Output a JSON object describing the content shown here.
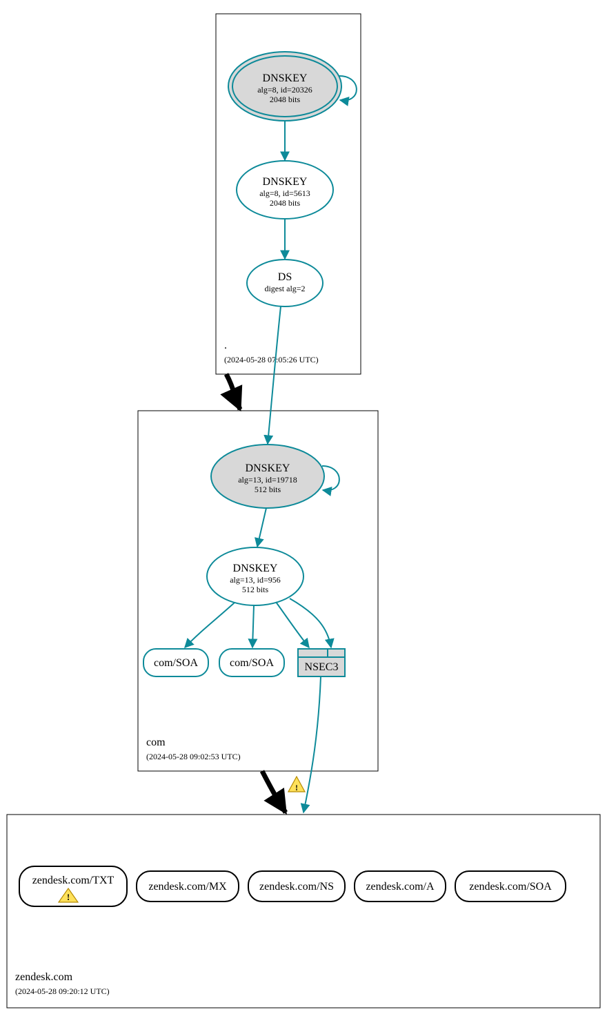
{
  "colors": {
    "teal": "#0d8a99",
    "black": "#000000",
    "gray_fill": "#d8d8d8",
    "white": "#ffffff",
    "warn_fill": "#ffe15a",
    "warn_stroke": "#b58a00"
  },
  "zones": {
    "root": {
      "name": ".",
      "timestamp": "(2024-05-28 07:05:26 UTC)"
    },
    "com": {
      "name": "com",
      "timestamp": "(2024-05-28 09:02:53 UTC)"
    },
    "zendesk": {
      "name": "zendesk.com",
      "timestamp": "(2024-05-28 09:20:12 UTC)"
    }
  },
  "nodes": {
    "root_ksk": {
      "title": "DNSKEY",
      "l1": "alg=8, id=20326",
      "l2": "2048 bits"
    },
    "root_zsk": {
      "title": "DNSKEY",
      "l1": "alg=8, id=5613",
      "l2": "2048 bits"
    },
    "root_ds": {
      "title": "DS",
      "l1": "digest alg=2"
    },
    "com_ksk": {
      "title": "DNSKEY",
      "l1": "alg=13, id=19718",
      "l2": "512 bits"
    },
    "com_zsk": {
      "title": "DNSKEY",
      "l1": "alg=13, id=956",
      "l2": "512 bits"
    },
    "com_soa1": {
      "title": "com/SOA"
    },
    "com_soa2": {
      "title": "com/SOA"
    },
    "com_nsec3": {
      "title": "NSEC3"
    },
    "z_txt": {
      "title": "zendesk.com/TXT"
    },
    "z_mx": {
      "title": "zendesk.com/MX"
    },
    "z_ns": {
      "title": "zendesk.com/NS"
    },
    "z_a": {
      "title": "zendesk.com/A"
    },
    "z_soa": {
      "title": "zendesk.com/SOA"
    }
  }
}
